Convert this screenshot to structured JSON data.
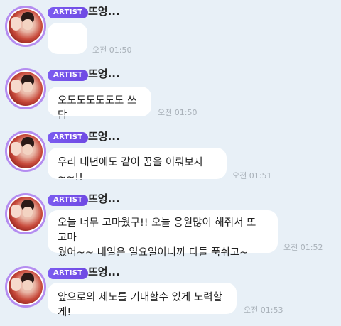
{
  "messages": [
    {
      "badge": "ARTIST",
      "name": "뜨엉...",
      "text": "",
      "time": "오전 01:50"
    },
    {
      "badge": "ARTIST",
      "name": "뜨엉...",
      "text": "오도도도도도도 쓰담",
      "time": "오전 01:50"
    },
    {
      "badge": "ARTIST",
      "name": "뜨엉...",
      "text": "우리 내년에도 같이 꿈을 이뤄보자~~!!",
      "time": "오전 01:51"
    },
    {
      "badge": "ARTIST",
      "name": "뜨엉...",
      "text_lines": [
        "오늘 너무 고마웠구!! 오늘 응원많이 해줘서 또 고마",
        "웠어~~ 내일은 일요일이니까 다들 푹쉬고~"
      ],
      "time": "오전 01:52"
    },
    {
      "badge": "ARTIST",
      "name": "뜨엉...",
      "text": "앞으로의 제노를 기대할수 있게 노력할게!",
      "time": "오전 01:53"
    }
  ],
  "colors": {
    "background": "#e8f0f7",
    "badge": "#7b5cf0",
    "avatar_ring": "#b48cf0",
    "bubble": "#ffffff",
    "time": "#a8b0b8"
  }
}
